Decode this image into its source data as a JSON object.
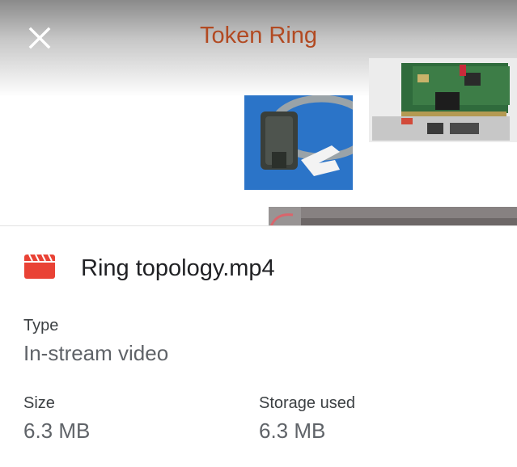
{
  "preview": {
    "slide_title": "Token Ring",
    "close_icon": "close-icon"
  },
  "file": {
    "icon": "video-file-icon",
    "icon_color": "#e94235",
    "name": "Ring topology.mp4"
  },
  "details": {
    "type_label": "Type",
    "type_value": "In-stream video",
    "size_label": "Size",
    "size_value": "6.3 MB",
    "storage_label": "Storage used",
    "storage_value": "6.3 MB"
  }
}
